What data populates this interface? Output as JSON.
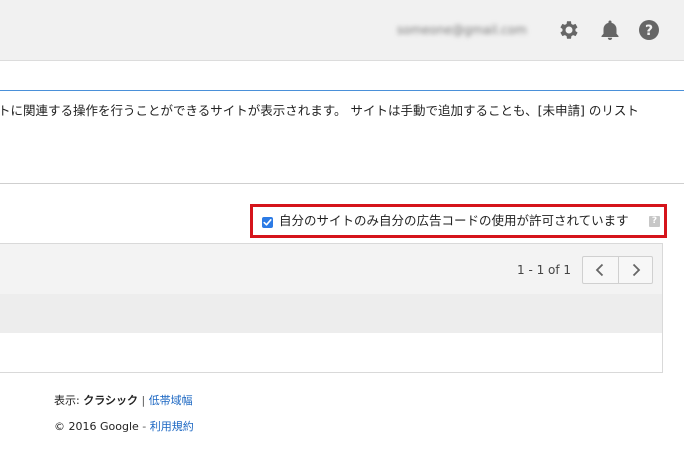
{
  "header": {
    "account_email": "someone@gmail.com",
    "icons": [
      "gear-icon",
      "bell-icon",
      "help-icon"
    ]
  },
  "main": {
    "description": "トに関連する操作を行うことができるサイトが表示されます。 サイトは手動で追加することも、[未申請] のリスト",
    "filter": {
      "checked": true,
      "label": "自分のサイトのみ自分の広告コードの使用が許可されています",
      "help_glyph": "?"
    },
    "table": {
      "pagination": "1 - 1 of 1"
    }
  },
  "footer": {
    "view_prefix": "表示: ",
    "view_current": "クラシック",
    "view_separator": " | ",
    "view_alt_link": "低帯域幅",
    "copyright": "© 2016 Google",
    "copyright_separator": " - ",
    "terms_link": "利用規約"
  },
  "colors": {
    "highlight_border": "#d5141b",
    "checkbox": "#2c7be5",
    "link": "#1a66c2",
    "accent_line": "#4a90d9"
  }
}
